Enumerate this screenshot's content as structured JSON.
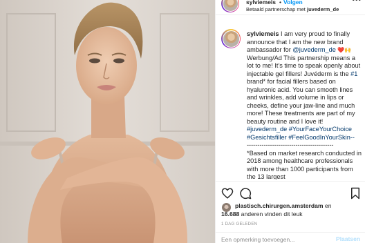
{
  "post": {
    "username": "sylviemeis",
    "separator": "•",
    "follow_label": "Volgen",
    "partner_prefix": "Betaald partnerschap met",
    "partner_brand": "juvederm_de",
    "more_icon": "more-dots-icon"
  },
  "caption": {
    "username": "sylviemeis",
    "text_1": " I am very proud to finally announce that I am the new brand ambassador for ",
    "mention": "@juvederm_de",
    "emoji": " ❤️🙌 ",
    "text_2": "Werbung/Ad This partnership means a lot to me! It's time to speak openly about injectable gel fillers! Juvéderm is the ",
    "hashtag_1": "#1",
    "text_3": " brand* for facial fillers based on hyaluronic acid. You can smooth lines and wrinkles, add volume in lips or cheeks, define your jaw-line and much more! These treatments are part of my beauty routine and I love it! ",
    "hashtags": "#juvederm_de #YourFaceYourChoice #Gesichtsfiller #FeelGoodInYourSkin--",
    "divider": "-----------------------------------------",
    "footnote": "*Based on market research conducted in 2018 among healthcare professionals with more than 1000 participants from the 13 largest"
  },
  "actions": {
    "like_icon": "heart-icon",
    "comment_icon": "comment-icon",
    "save_icon": "bookmark-icon"
  },
  "likes": {
    "liker": "plastisch.chirurgen.amsterdam",
    "line1_suffix": " en",
    "count": "16.688",
    "line2_suffix": " anderen vinden dit leuk"
  },
  "timestamp": "1 DAG GELEDEN",
  "comment": {
    "placeholder": "Een opmerking toevoegen...",
    "post_label": "Plaatsen"
  }
}
